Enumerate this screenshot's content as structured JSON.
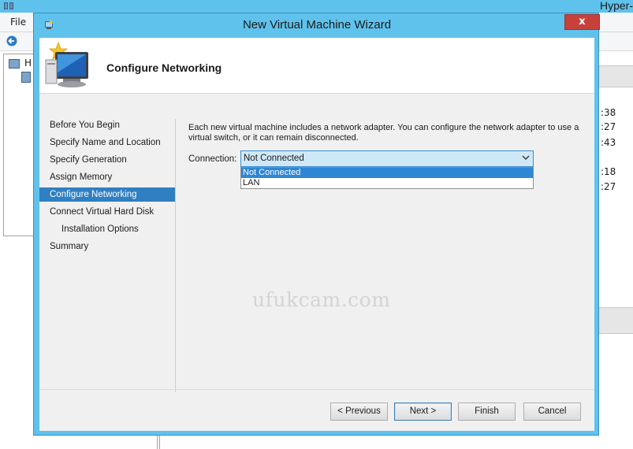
{
  "background_app": {
    "title": "Hyper-",
    "menu": {
      "file": "File"
    },
    "tree": {
      "root_label": "H"
    },
    "right_panel": {
      "times": [
        ":38",
        ":27",
        ":43",
        ":18",
        ":27"
      ]
    }
  },
  "wizard": {
    "title": "New Virtual Machine Wizard",
    "close_glyph": "x",
    "page_title": "Configure Networking",
    "nav": [
      {
        "label": "Before You Begin",
        "selected": false,
        "indent": false
      },
      {
        "label": "Specify Name and Location",
        "selected": false,
        "indent": false
      },
      {
        "label": "Specify Generation",
        "selected": false,
        "indent": false
      },
      {
        "label": "Assign Memory",
        "selected": false,
        "indent": false
      },
      {
        "label": "Configure Networking",
        "selected": true,
        "indent": false
      },
      {
        "label": "Connect Virtual Hard Disk",
        "selected": false,
        "indent": false
      },
      {
        "label": "Installation Options",
        "selected": false,
        "indent": true
      },
      {
        "label": "Summary",
        "selected": false,
        "indent": false
      }
    ],
    "description": "Each new virtual machine includes a network adapter. You can configure the network adapter to use a virtual switch, or it can remain disconnected.",
    "connection": {
      "label": "Connection:",
      "value": "Not Connected",
      "options": [
        {
          "label": "Not Connected",
          "highlighted": true
        },
        {
          "label": "LAN",
          "highlighted": false
        }
      ]
    },
    "watermark": "ufukcam.com",
    "buttons": {
      "previous": "< Previous",
      "next": "Next >",
      "finish": "Finish",
      "cancel": "Cancel"
    }
  },
  "colors": {
    "titlebar": "#5fc2ec",
    "selection": "#2f7fc2",
    "close_button": "#c7413a",
    "dropdown_highlight": "#2f86d5"
  }
}
